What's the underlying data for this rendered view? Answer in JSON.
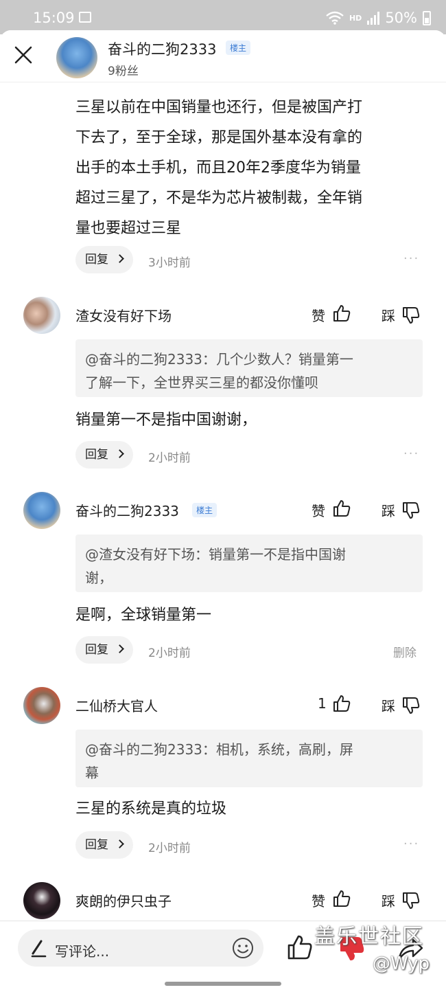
{
  "status_bar": {
    "time": "15:09",
    "network": "HD",
    "battery": "50%"
  },
  "header": {
    "name": "奋斗的二狗2333",
    "badge": "楼主",
    "fans": "9粉丝"
  },
  "first_comment": {
    "lines": [
      "三星以前在中国销量也还行，但是被国产打",
      "下去了，至于全球，那是国外基本没有拿的",
      "出手的本土手机，而且20年2季度华为销量",
      "超过三星了，不是华为芯片被制裁，全年销",
      "量也要超过三星"
    ],
    "reply_label": "回复",
    "time": "3小时前",
    "more": "···"
  },
  "comments": [
    {
      "username": "渣女没有好下场",
      "like_label": "赞",
      "dislike_label": "踩",
      "quote_lines": [
        "@奋斗的二狗2333：几个少数人？销量第一",
        "了解一下，全世界买三星的都没你懂呗"
      ],
      "text": "销量第一不是指中国谢谢，",
      "reply_label": "回复",
      "time": "2小时前",
      "more": "···"
    },
    {
      "username": "奋斗的二狗2333",
      "badge": "楼主",
      "like_label": "赞",
      "dislike_label": "踩",
      "quote_lines": [
        "@渣女没有好下场：销量第一不是指中国谢",
        "谢，"
      ],
      "text": "是啊，全球销量第一",
      "reply_label": "回复",
      "time": "2小时前",
      "delete_label": "删除"
    },
    {
      "username": "二仙桥大官人",
      "like_count": "1",
      "dislike_label": "踩",
      "quote_lines": [
        "@奋斗的二狗2333：相机，系统，高刷，屏",
        "幕"
      ],
      "text": "三星的系统是真的垃圾",
      "reply_label": "回复",
      "time": "2小时前",
      "more": "···"
    },
    {
      "username": "爽朗的伊只虫子",
      "like_label": "赞",
      "dislike_label": "踩"
    }
  ],
  "bottom_bar": {
    "placeholder": "写评论...",
    "watermark_title": "盖乐世社区",
    "watermark_handle": "@Wyp"
  },
  "colors": {
    "status_bar_bg": "#c9c9c9",
    "badge_blue": "#3b7bd3",
    "dislike_red": "#e0333a"
  },
  "icons": [
    "close-icon",
    "thumb-up-icon",
    "thumb-down-icon",
    "pen-icon",
    "emoji-icon",
    "share-icon",
    "more-icon",
    "chevron-right-icon",
    "wifi-icon",
    "signal-icon",
    "battery-icon",
    "photo-icon"
  ]
}
